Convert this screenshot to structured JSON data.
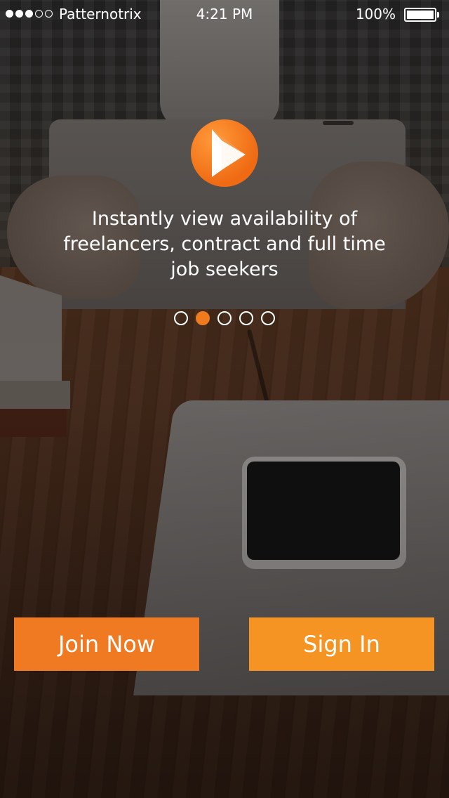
{
  "status_bar": {
    "signal_dots": [
      "full",
      "full",
      "full",
      "empty",
      "empty"
    ],
    "carrier": "Patternotrix",
    "time": "4:21 PM",
    "battery_percent": "100%",
    "battery_level": 1.0
  },
  "onboarding": {
    "logo_icon": "play-logo-icon",
    "headline": "Instantly view availability of freelancers, contract and full time job seekers",
    "pager": {
      "total": 5,
      "active_index": 1
    }
  },
  "actions": {
    "join_label": "Join Now",
    "signin_label": "Sign In"
  },
  "colors": {
    "accent": "#f07a1e",
    "join_button": "#ef7a22",
    "signin_button": "#f59423"
  }
}
